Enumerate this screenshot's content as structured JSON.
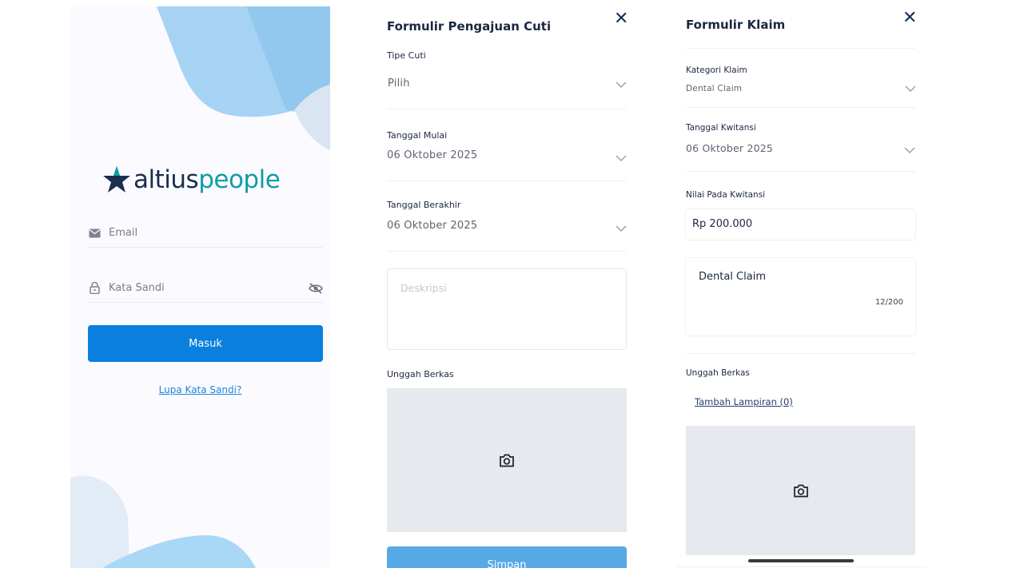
{
  "login": {
    "brand_part1": "altius",
    "brand_part2": "people",
    "email_placeholder": "Email",
    "password_placeholder": "Kata Sandi",
    "login_button": "Masuk",
    "forgot_link": "Lupa Kata Sandi?",
    "colors": {
      "primary": "#0a7fde",
      "link": "#1d86d9",
      "brand_dark": "#1a2e4d",
      "brand_teal": "#0e9ea5"
    }
  },
  "leave_form": {
    "title": "Formulir Pengajuan Cuti",
    "leave_type_label": "Tipe Cuti",
    "leave_type_value": "Pilih",
    "start_date_label": "Tanggal Mulai",
    "start_date_value": "06 Oktober 2025",
    "end_date_label": "Tanggal Berakhir",
    "end_date_value": "06 Oktober 2025",
    "description_placeholder": "Deskripsi",
    "upload_label": "Unggah Berkas",
    "save_button": "Simpan"
  },
  "claim_form": {
    "title": "Formulir Klaim",
    "category_label": "Kategori Klaim",
    "category_value": "Dental Claim",
    "receipt_date_label": "Tanggal Kwitansi",
    "receipt_date_value": "06 Oktober 2025",
    "receipt_value_label": "Nilai Pada Kwitansi",
    "receipt_value": "Rp 200.000",
    "description_value": "Dental Claim",
    "char_counter": "12/200",
    "upload_label": "Unggah Berkas",
    "add_attachment_link": "Tambah Lampiran (0)"
  },
  "icons": [
    "mail-icon",
    "lock-icon",
    "eye-off-icon",
    "close-icon",
    "chevron-down-icon",
    "camera-icon",
    "star-logo-icon"
  ]
}
